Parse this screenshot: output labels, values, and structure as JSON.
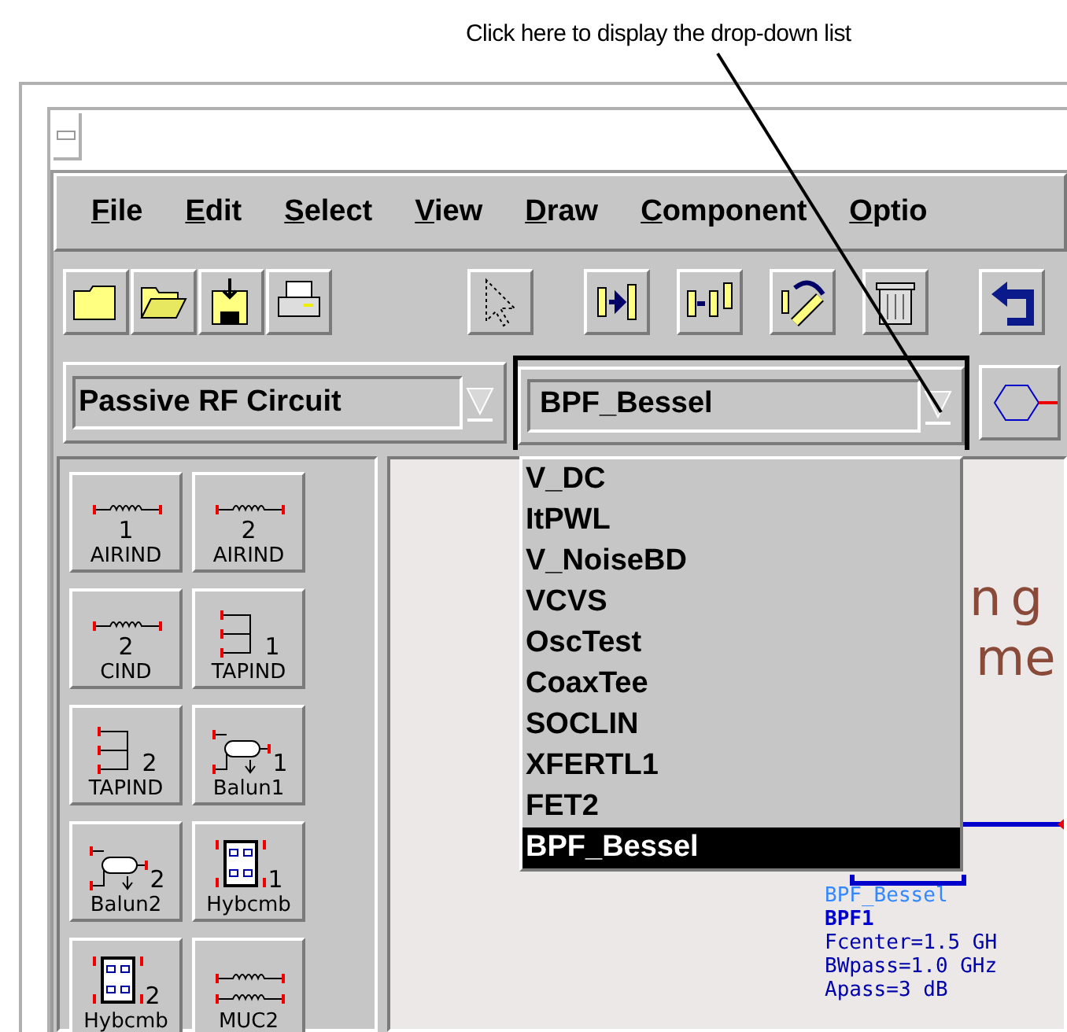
{
  "annotation": {
    "text": "Click here to display the drop-down list"
  },
  "menu": [
    "File",
    "Edit",
    "Select",
    "View",
    "Draw",
    "Component",
    "Optio"
  ],
  "library_combo": {
    "value": "Passive RF Circuit"
  },
  "component_combo": {
    "value": "BPF_Bessel",
    "expanded": true
  },
  "dropdown": [
    {
      "label": "V_DC",
      "selected": false
    },
    {
      "label": "ItPWL",
      "selected": false
    },
    {
      "label": "V_NoiseBD",
      "selected": false
    },
    {
      "label": "VCVS",
      "selected": false
    },
    {
      "label": "OscTest",
      "selected": false
    },
    {
      "label": "CoaxTee",
      "selected": false
    },
    {
      "label": "SOCLIN",
      "selected": false
    },
    {
      "label": "XFERTL1",
      "selected": false
    },
    {
      "label": "FET2",
      "selected": false
    },
    {
      "label": "BPF_Bessel",
      "selected": true
    }
  ],
  "palette": [
    {
      "kind": "coil",
      "number": "1",
      "label": "AIRIND"
    },
    {
      "kind": "coil",
      "number": "2",
      "label": "AIRIND"
    },
    {
      "kind": "coil",
      "number": "2",
      "label": "CIND"
    },
    {
      "kind": "tapped",
      "number": "1",
      "label": "TAPIND"
    },
    {
      "kind": "tapped",
      "number": "2",
      "label": "TAPIND"
    },
    {
      "kind": "balun",
      "number": "1",
      "label": "Balun1"
    },
    {
      "kind": "balun",
      "number": "2",
      "label": "Balun2"
    },
    {
      "kind": "hybrid",
      "number": "1",
      "label": "Hybcmb"
    },
    {
      "kind": "hybrid",
      "number": "2",
      "label": "Hybcmb"
    },
    {
      "kind": "coupled",
      "label": "MUC2"
    }
  ],
  "canvas": {
    "title_lines": [
      "ng",
      "me"
    ],
    "component": {
      "name": "BPF_Bessel",
      "instance": "BPF1",
      "params": [
        "Fcenter=1.5 GH",
        "BWpass=1.0 GHz",
        "Apass=3 dB"
      ]
    }
  }
}
